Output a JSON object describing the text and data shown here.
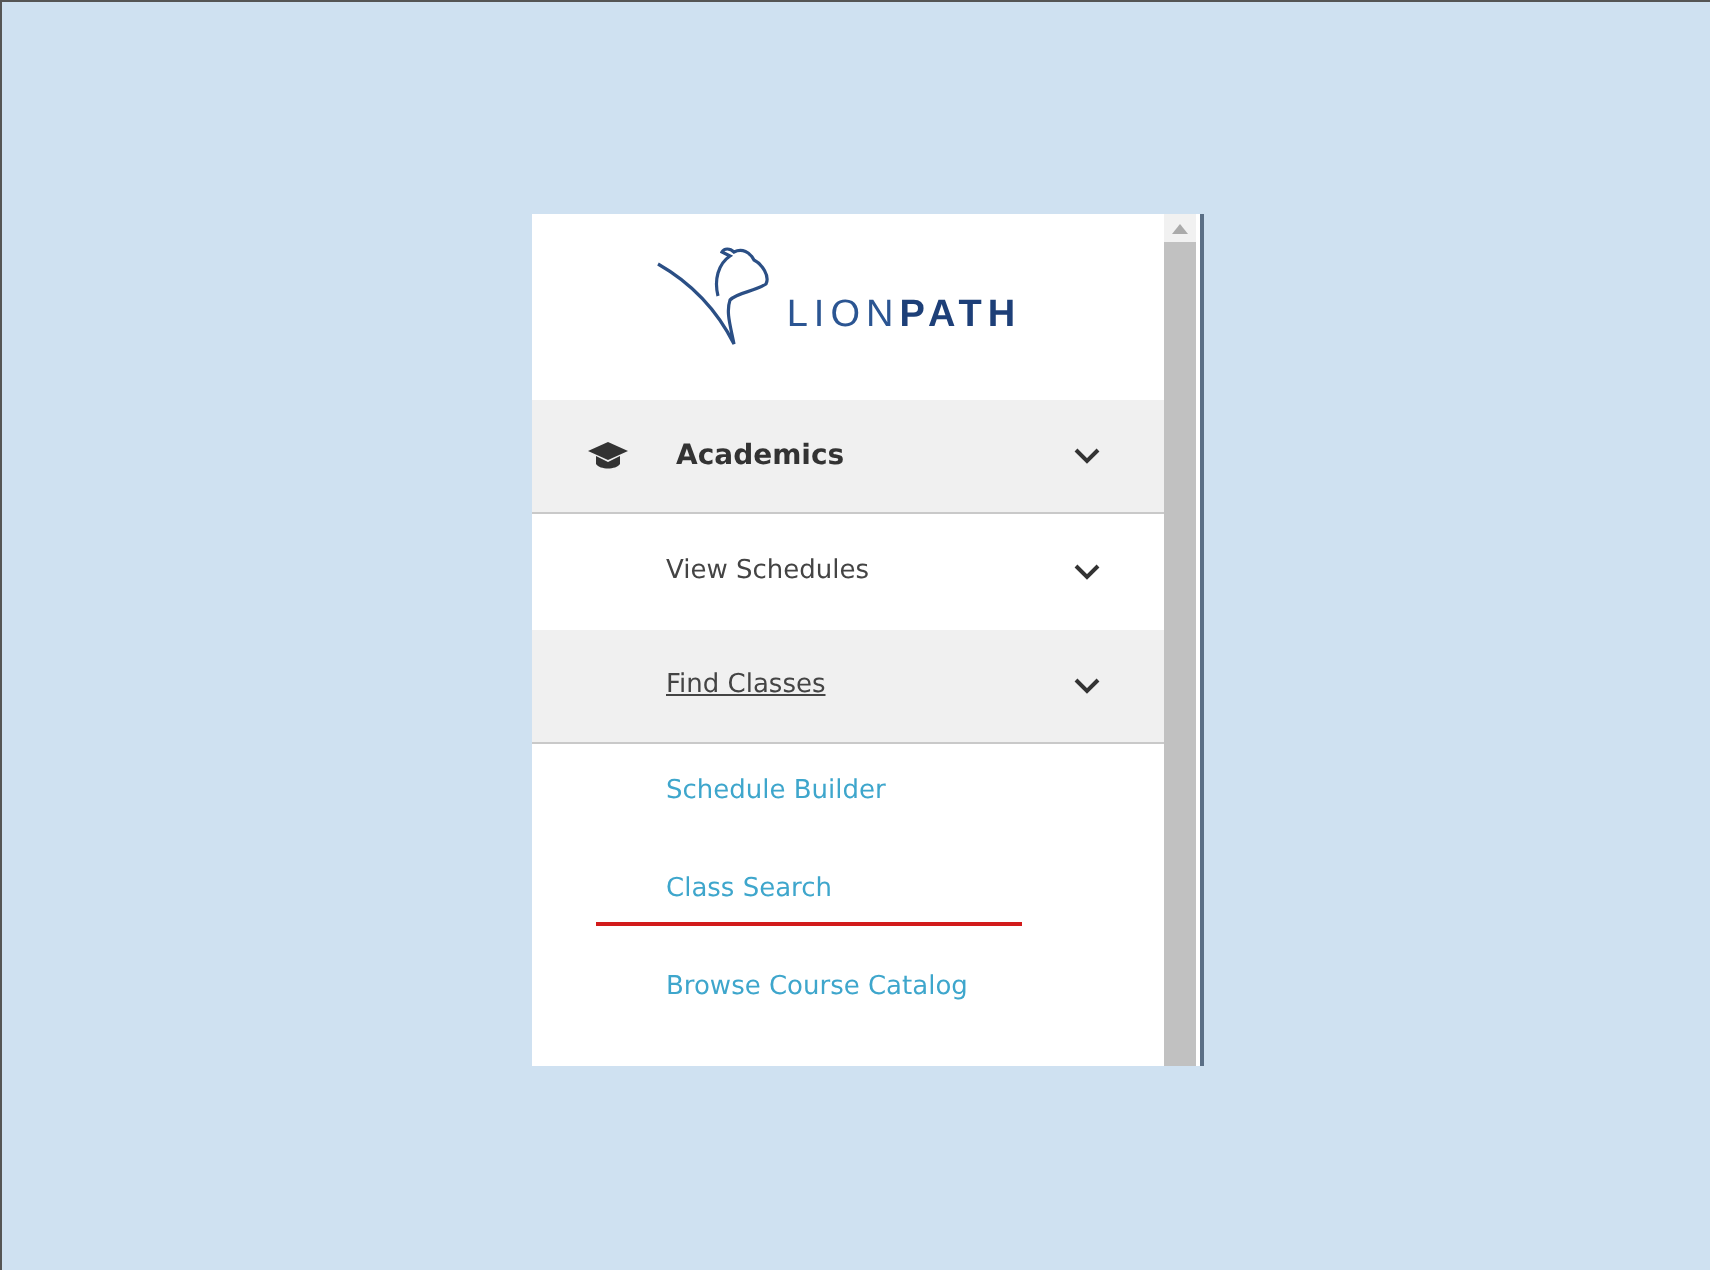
{
  "logo": {
    "text": "LION**PATH**"
  },
  "section": {
    "label": "Academics"
  },
  "menu_items": [
    {
      "label": "View Schedules",
      "current": false
    },
    {
      "label": "Find Classes",
      "current": true
    }
  ],
  "links": [
    {
      "label": "Schedule Builder",
      "marked": false
    },
    {
      "label": "Class Search",
      "marked": true
    },
    {
      "label": "Browse Course Catalog",
      "marked": false
    }
  ]
}
